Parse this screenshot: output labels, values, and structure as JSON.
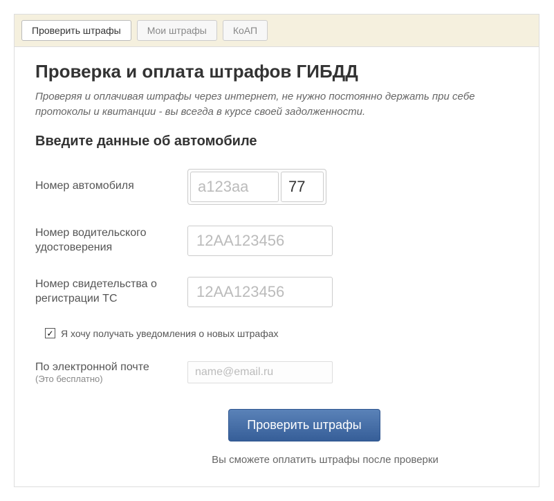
{
  "tabs": {
    "check": "Проверить штрафы",
    "my": "Мои штрафы",
    "koap": "КоАП"
  },
  "heading": "Проверка и оплата штрафов ГИБДД",
  "subtitle": "Проверяя и оплачивая штрафы через интернет, не нужно постоянно держать при себе протоколы и квитанции - вы всегда в курсе своей задолженности.",
  "section_heading": "Введите данные об автомобиле",
  "fields": {
    "car_number": {
      "label": "Номер автомобиля",
      "placeholder": "а123аа",
      "region_value": "77"
    },
    "license": {
      "label": "Номер водительского удостоверения",
      "placeholder": "12АА123456"
    },
    "registration": {
      "label": "Номер свидетельства о регистрации ТС",
      "placeholder": "12АА123456"
    },
    "notify_checkbox": {
      "checked": true,
      "label": "Я хочу получать уведомления о новых штрафах"
    },
    "email": {
      "label": "По электронной почте",
      "sublabel": "(Это бесплатно)",
      "placeholder": "name@email.ru"
    }
  },
  "submit_label": "Проверить штрафы",
  "footer_note": "Вы сможете оплатить штрафы после проверки"
}
